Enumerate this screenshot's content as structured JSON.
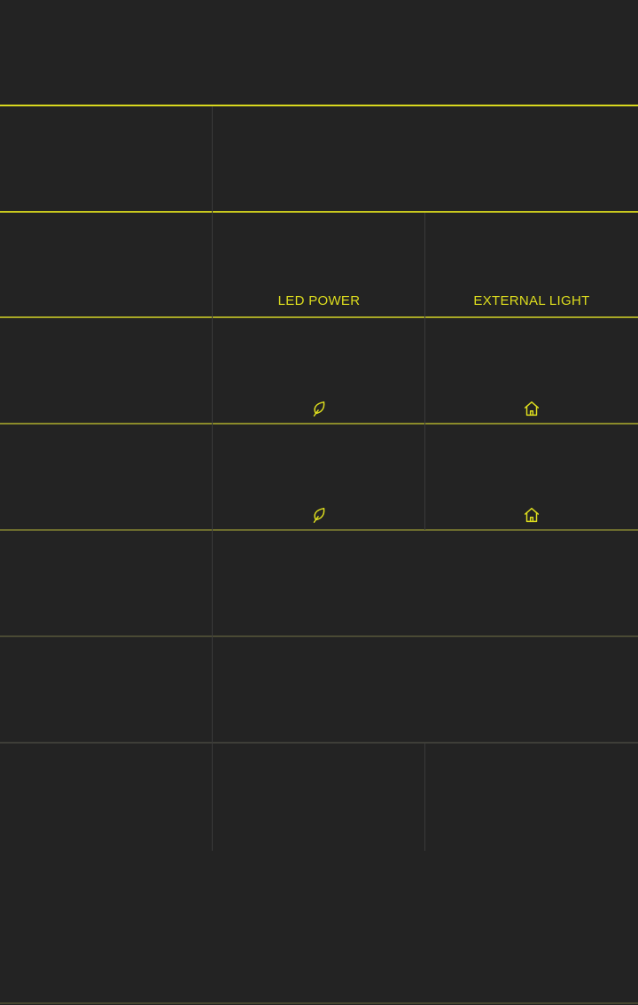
{
  "table": {
    "headers": {
      "led_power": "LED POWER",
      "external_light": "EXTERNAL LIGHT"
    },
    "rows": [
      {
        "led_power_icon": "leaf-icon",
        "external_light_icon": "home-icon"
      },
      {
        "led_power_icon": "leaf-icon",
        "external_light_icon": "home-icon"
      }
    ]
  },
  "colors": {
    "background": "#232323",
    "accent": "#dede1e",
    "accent_dim": "#7d7d2a",
    "grid": "#3c3c3c"
  }
}
